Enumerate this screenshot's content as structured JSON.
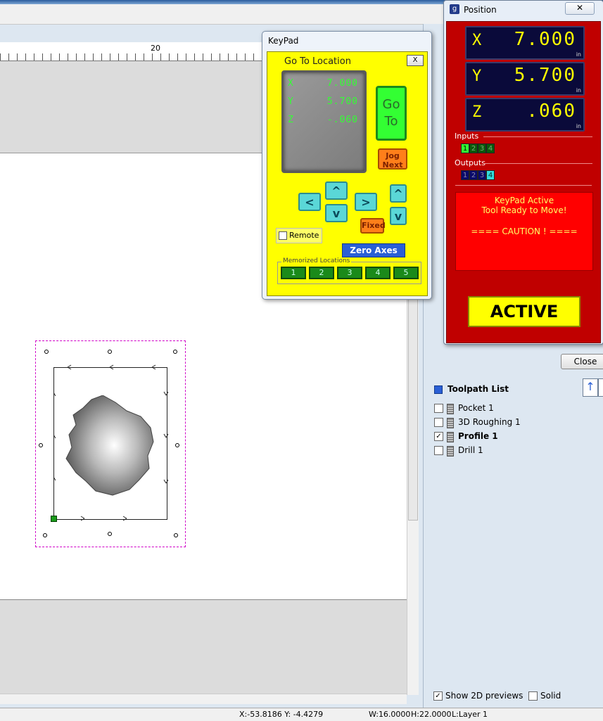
{
  "ruler": {
    "label": "20"
  },
  "keypad": {
    "title": "KeyPad",
    "goto_title": "Go To Location",
    "close": "X",
    "lcd": [
      {
        "axis": "X",
        "value": "7.000"
      },
      {
        "axis": "Y",
        "value": "5.700"
      },
      {
        "axis": "Z",
        "value": "-.060"
      }
    ],
    "goto_label": "Go To",
    "jog_label": "Jog Next",
    "arrows": {
      "left": "<",
      "right": ">",
      "up": "^",
      "down": "v",
      "z_up": "^",
      "z_down": "v"
    },
    "fixed_label": "Fixed",
    "remote_label": "Remote",
    "zero_axes_label": "Zero Axes",
    "memorized_label": "Memorized Locations",
    "memorized": [
      "1",
      "2",
      "3",
      "4",
      "5"
    ]
  },
  "position": {
    "title": "Position",
    "close": "✕",
    "dro": [
      {
        "axis": "X",
        "value": "7.000",
        "unit": "in"
      },
      {
        "axis": "Y",
        "value": "5.700",
        "unit": "in"
      },
      {
        "axis": "Z",
        "value": ".060",
        "unit": "in"
      }
    ],
    "inputs_label": "Inputs",
    "inputs": [
      "1",
      "2",
      "3",
      "4"
    ],
    "outputs_label": "Outputs",
    "outputs": [
      "1",
      "2",
      "3",
      "4"
    ],
    "message_line1": "KeyPad Active",
    "message_line2": "Tool Ready to Move!",
    "message_line3": "==== CAUTION ! ====",
    "active_label": "ACTIVE"
  },
  "panel": {
    "close_label": "Close",
    "toolpath_list_title": "Toolpath List",
    "toolpaths": [
      {
        "name": "Pocket 1",
        "checked": false
      },
      {
        "name": "3D Roughing 1",
        "checked": false
      },
      {
        "name": "Profile 1",
        "checked": true
      },
      {
        "name": "Drill 1",
        "checked": false
      }
    ],
    "show_2d_label": "Show 2D previews",
    "solid_label": "Solid"
  },
  "status": {
    "coords": "X:-53.8186 Y: -4.4279",
    "width": "W:16.0000",
    "height": "H:22.0000",
    "layer": "L:Layer 1"
  },
  "colors": {
    "keypad_bg": "#ffff00",
    "position_bg": "#c00000",
    "dro_text": "#ffff00",
    "selection": "#d000c8"
  }
}
